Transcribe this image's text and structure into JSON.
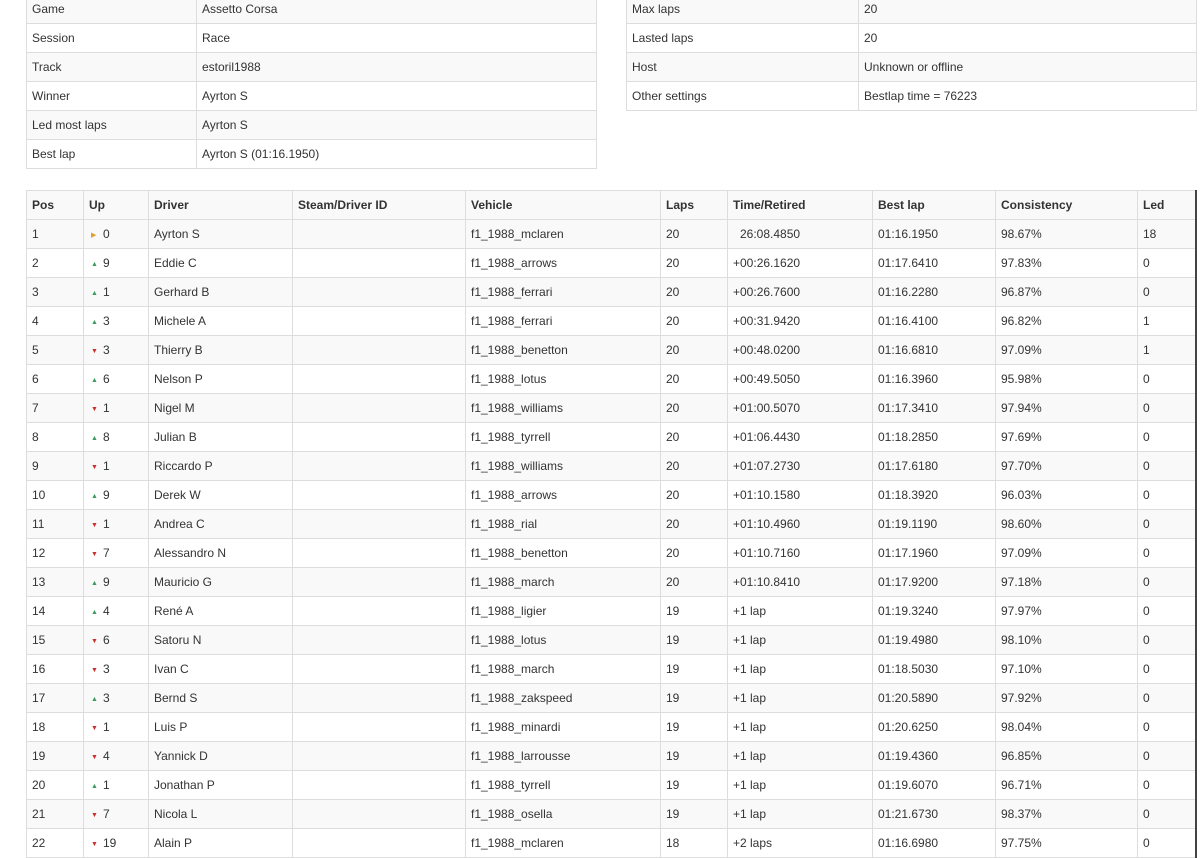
{
  "session_info_left": [
    {
      "label": "Game",
      "value": "Assetto Corsa"
    },
    {
      "label": "Session",
      "value": "Race"
    },
    {
      "label": "Track",
      "value": "estoril1988"
    },
    {
      "label": "Winner",
      "value": "Ayrton S"
    },
    {
      "label": "Led most laps",
      "value": "Ayrton S"
    },
    {
      "label": "Best lap",
      "value": "Ayrton S (01:16.1950)"
    }
  ],
  "session_info_right": [
    {
      "label": "Max laps",
      "value": "20"
    },
    {
      "label": "Lasted laps",
      "value": "20"
    },
    {
      "label": "Host",
      "value": "Unknown or offline"
    },
    {
      "label": "Other settings",
      "value": "Bestlap time = 76223"
    }
  ],
  "results": {
    "columns": [
      "Pos",
      "Up",
      "Driver",
      "Steam/Driver ID",
      "Vehicle",
      "Laps",
      "Time/Retired",
      "Best lap",
      "Consistency",
      "Led"
    ],
    "rows": [
      {
        "pos": "1",
        "up_dir": "same",
        "up": "0",
        "driver": "Ayrton S",
        "id": "",
        "vehicle": "f1_1988_mclaren",
        "laps": "20",
        "time": "26:08.4850",
        "best": "01:16.1950",
        "consistency": "98.67%",
        "led": "18"
      },
      {
        "pos": "2",
        "up_dir": "up",
        "up": "9",
        "driver": "Eddie C",
        "id": "",
        "vehicle": "f1_1988_arrows",
        "laps": "20",
        "time": "+00:26.1620",
        "best": "01:17.6410",
        "consistency": "97.83%",
        "led": "0"
      },
      {
        "pos": "3",
        "up_dir": "up",
        "up": "1",
        "driver": "Gerhard B",
        "id": "",
        "vehicle": "f1_1988_ferrari",
        "laps": "20",
        "time": "+00:26.7600",
        "best": "01:16.2280",
        "consistency": "96.87%",
        "led": "0"
      },
      {
        "pos": "4",
        "up_dir": "up",
        "up": "3",
        "driver": "Michele A",
        "id": "",
        "vehicle": "f1_1988_ferrari",
        "laps": "20",
        "time": "+00:31.9420",
        "best": "01:16.4100",
        "consistency": "96.82%",
        "led": "1"
      },
      {
        "pos": "5",
        "up_dir": "down",
        "up": "3",
        "driver": "Thierry B",
        "id": "",
        "vehicle": "f1_1988_benetton",
        "laps": "20",
        "time": "+00:48.0200",
        "best": "01:16.6810",
        "consistency": "97.09%",
        "led": "1"
      },
      {
        "pos": "6",
        "up_dir": "up",
        "up": "6",
        "driver": "Nelson P",
        "id": "",
        "vehicle": "f1_1988_lotus",
        "laps": "20",
        "time": "+00:49.5050",
        "best": "01:16.3960",
        "consistency": "95.98%",
        "led": "0"
      },
      {
        "pos": "7",
        "up_dir": "down",
        "up": "1",
        "driver": "Nigel M",
        "id": "",
        "vehicle": "f1_1988_williams",
        "laps": "20",
        "time": "+01:00.5070",
        "best": "01:17.3410",
        "consistency": "97.94%",
        "led": "0"
      },
      {
        "pos": "8",
        "up_dir": "up",
        "up": "8",
        "driver": "Julian B",
        "id": "",
        "vehicle": "f1_1988_tyrrell",
        "laps": "20",
        "time": "+01:06.4430",
        "best": "01:18.2850",
        "consistency": "97.69%",
        "led": "0"
      },
      {
        "pos": "9",
        "up_dir": "down",
        "up": "1",
        "driver": "Riccardo P",
        "id": "",
        "vehicle": "f1_1988_williams",
        "laps": "20",
        "time": "+01:07.2730",
        "best": "01:17.6180",
        "consistency": "97.70%",
        "led": "0"
      },
      {
        "pos": "10",
        "up_dir": "up",
        "up": "9",
        "driver": "Derek W",
        "id": "",
        "vehicle": "f1_1988_arrows",
        "laps": "20",
        "time": "+01:10.1580",
        "best": "01:18.3920",
        "consistency": "96.03%",
        "led": "0"
      },
      {
        "pos": "11",
        "up_dir": "down",
        "up": "1",
        "driver": "Andrea C",
        "id": "",
        "vehicle": "f1_1988_rial",
        "laps": "20",
        "time": "+01:10.4960",
        "best": "01:19.1190",
        "consistency": "98.60%",
        "led": "0"
      },
      {
        "pos": "12",
        "up_dir": "down",
        "up": "7",
        "driver": "Alessandro N",
        "id": "",
        "vehicle": "f1_1988_benetton",
        "laps": "20",
        "time": "+01:10.7160",
        "best": "01:17.1960",
        "consistency": "97.09%",
        "led": "0"
      },
      {
        "pos": "13",
        "up_dir": "up",
        "up": "9",
        "driver": "Mauricio G",
        "id": "",
        "vehicle": "f1_1988_march",
        "laps": "20",
        "time": "+01:10.8410",
        "best": "01:17.9200",
        "consistency": "97.18%",
        "led": "0"
      },
      {
        "pos": "14",
        "up_dir": "up",
        "up": "4",
        "driver": "René A",
        "id": "",
        "vehicle": "f1_1988_ligier",
        "laps": "19",
        "time": "+1 lap",
        "best": "01:19.3240",
        "consistency": "97.97%",
        "led": "0"
      },
      {
        "pos": "15",
        "up_dir": "down",
        "up": "6",
        "driver": "Satoru N",
        "id": "",
        "vehicle": "f1_1988_lotus",
        "laps": "19",
        "time": "+1 lap",
        "best": "01:19.4980",
        "consistency": "98.10%",
        "led": "0"
      },
      {
        "pos": "16",
        "up_dir": "down",
        "up": "3",
        "driver": "Ivan C",
        "id": "",
        "vehicle": "f1_1988_march",
        "laps": "19",
        "time": "+1 lap",
        "best": "01:18.5030",
        "consistency": "97.10%",
        "led": "0"
      },
      {
        "pos": "17",
        "up_dir": "up",
        "up": "3",
        "driver": "Bernd S",
        "id": "",
        "vehicle": "f1_1988_zakspeed",
        "laps": "19",
        "time": "+1 lap",
        "best": "01:20.5890",
        "consistency": "97.92%",
        "led": "0"
      },
      {
        "pos": "18",
        "up_dir": "down",
        "up": "1",
        "driver": "Luis P",
        "id": "",
        "vehicle": "f1_1988_minardi",
        "laps": "19",
        "time": "+1 lap",
        "best": "01:20.6250",
        "consistency": "98.04%",
        "led": "0"
      },
      {
        "pos": "19",
        "up_dir": "down",
        "up": "4",
        "driver": "Yannick D",
        "id": "",
        "vehicle": "f1_1988_larrousse",
        "laps": "19",
        "time": "+1 lap",
        "best": "01:19.4360",
        "consistency": "96.85%",
        "led": "0"
      },
      {
        "pos": "20",
        "up_dir": "up",
        "up": "1",
        "driver": "Jonathan P",
        "id": "",
        "vehicle": "f1_1988_tyrrell",
        "laps": "19",
        "time": "+1 lap",
        "best": "01:19.6070",
        "consistency": "96.71%",
        "led": "0"
      },
      {
        "pos": "21",
        "up_dir": "down",
        "up": "7",
        "driver": "Nicola L",
        "id": "",
        "vehicle": "f1_1988_osella",
        "laps": "19",
        "time": "+1 lap",
        "best": "01:21.6730",
        "consistency": "98.37%",
        "led": "0"
      },
      {
        "pos": "22",
        "up_dir": "down",
        "up": "19",
        "driver": "Alain P",
        "id": "",
        "vehicle": "f1_1988_mclaren",
        "laps": "18",
        "time": "+2 laps",
        "best": "01:16.6980",
        "consistency": "97.75%",
        "led": "0"
      }
    ]
  },
  "colors": {
    "up_arrow": "#3c9a5f",
    "down_arrow": "#c9302c",
    "same_arrow": "#e0a030"
  }
}
